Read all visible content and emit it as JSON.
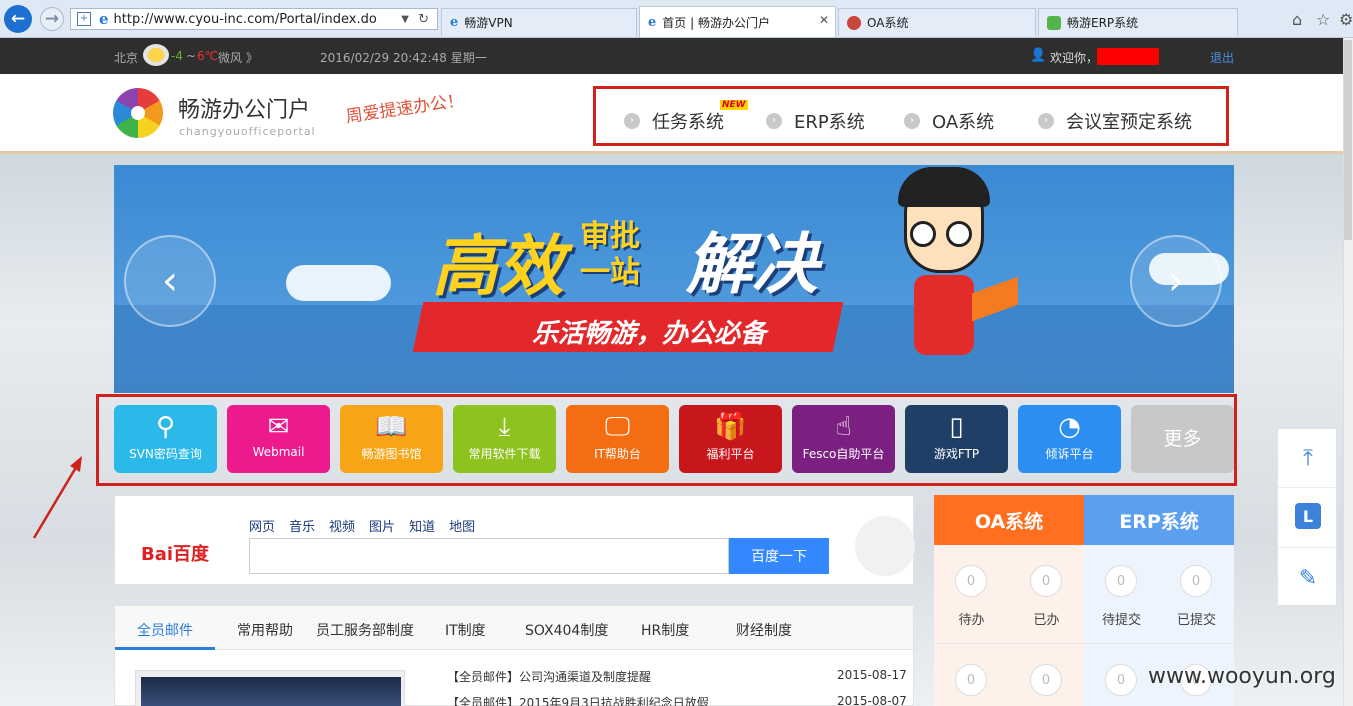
{
  "browser": {
    "url": "http://www.cyou-inc.com/Portal/index.do",
    "tabs": [
      {
        "label": "畅游VPN",
        "active": false
      },
      {
        "label": "首页 | 畅游办公门户",
        "active": true
      },
      {
        "label": "OA系统",
        "active": false
      },
      {
        "label": "畅游ERP系统",
        "active": false
      }
    ]
  },
  "topbar": {
    "city": "北京",
    "temp_low": "-4",
    "sep": "~",
    "temp_high": "6℃",
    "wind": "微风 》",
    "datetime": "2016/02/29 20:42:48 星期一",
    "welcome": "欢迎你，",
    "logout": "退出"
  },
  "header": {
    "site_name": "畅游办公门户",
    "site_pinyin": "changyouofficeportal",
    "slogan": "周爱提速办公！",
    "nav": [
      {
        "label": "任务系统",
        "badge": "NEW"
      },
      {
        "label": "ERP系统"
      },
      {
        "label": "OA系统"
      },
      {
        "label": "会议室预定系统"
      }
    ]
  },
  "banner": {
    "line1": "高效",
    "line1b": "审批",
    "line1c": "一站",
    "line1d": "解决",
    "line2": "乐活畅游，办公必备",
    "prev": "‹",
    "next": "›"
  },
  "tiles": [
    {
      "label": "SVN密码查询",
      "color": "#2bb9ea",
      "icon": "search-icon",
      "glyph": "⚲"
    },
    {
      "label": "Webmail",
      "color": "#ec1a8c",
      "icon": "mail-icon",
      "glyph": "✉"
    },
    {
      "label": "畅游图书馆",
      "color": "#f7a417",
      "icon": "book-icon",
      "glyph": "📖"
    },
    {
      "label": "常用软件下载",
      "color": "#8dc21f",
      "icon": "download-icon",
      "glyph": "⤓"
    },
    {
      "label": "IT帮助台",
      "color": "#f46d12",
      "icon": "monitor-icon",
      "glyph": "🖵"
    },
    {
      "label": "福利平台",
      "color": "#c8161d",
      "icon": "gift-icon",
      "glyph": "🎁"
    },
    {
      "label": "Fesco自助平台",
      "color": "#7b1f80",
      "icon": "touch-icon",
      "glyph": "☝"
    },
    {
      "label": "游戏FTP",
      "color": "#1f3f66",
      "icon": "usb-icon",
      "glyph": "▯"
    },
    {
      "label": "倾诉平台",
      "color": "#2b8ef0",
      "icon": "ear-icon",
      "glyph": "◔"
    },
    {
      "label": "更多",
      "color": "#c8c8c8",
      "icon": "",
      "glyph": ""
    }
  ],
  "baidu": {
    "logo": "Bai百度",
    "links": [
      "网页",
      "音乐",
      "视频",
      "图片",
      "知道",
      "地图"
    ],
    "search_value": "",
    "button": "百度一下"
  },
  "news": {
    "tabs": [
      "全员邮件",
      "常用帮助",
      "员工服务部制度",
      "IT制度",
      "SOX404制度",
      "HR制度",
      "财经制度"
    ],
    "items": [
      {
        "title": "【全员邮件】公司沟通渠道及制度提醒",
        "date": "2015-08-17"
      },
      {
        "title": "【全员邮件】2015年9月3日抗战胜利纪念日放假",
        "date": "2015-08-07"
      }
    ]
  },
  "systems": {
    "oa_title": "OA系统",
    "erp_title": "ERP系统",
    "oa_counts": [
      {
        "n": "0",
        "label": "待办"
      },
      {
        "n": "0",
        "label": "已办"
      }
    ],
    "erp_counts": [
      {
        "n": "0",
        "label": "待提交"
      },
      {
        "n": "0",
        "label": "已提交"
      }
    ],
    "row2": [
      "0",
      "0",
      "0",
      "0"
    ]
  },
  "watermark": "www.wooyun.org"
}
